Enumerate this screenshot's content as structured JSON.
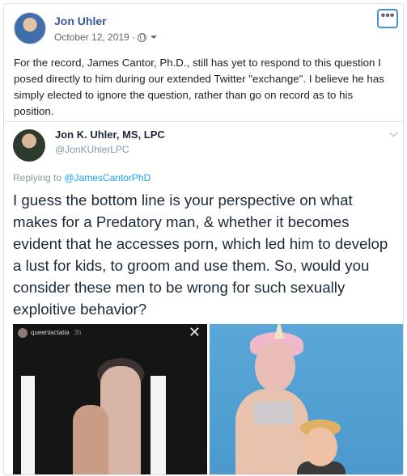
{
  "post": {
    "author_name": "Jon Uhler",
    "date": "October 12, 2019 ·",
    "privacy_icon": "globe-icon",
    "more_icon": "more-dots-icon",
    "more_label": "•••",
    "text": "For the record, James Cantor, Ph.D., still has yet to respond to this question I posed directly to him during our extended Twitter \"exchange\". I believe he has simply elected to ignore the question, rather than go on record as to his position."
  },
  "embed": {
    "name": "Jon K. Uhler, MS, LPC",
    "handle": "@JonKUhlerLPC",
    "replying_prefix": "Replying to ",
    "replying_to": "@JamesCantorPhD",
    "tweet_text": "I guess the bottom line is your perspective on what makes for a Predatory man, & whether it becomes evident that he accesses porn, which led him to develop a lust for kids, to groom and use them. So, would you consider these men to be wrong for such sexually exploitive behavior?",
    "media": {
      "left_story_user": "queenlactatia",
      "left_story_time": "3h",
      "left_close": "✕"
    }
  },
  "colors": {
    "link": "#385898",
    "twitter_blue": "#1da1f2",
    "muted": "#606770"
  }
}
